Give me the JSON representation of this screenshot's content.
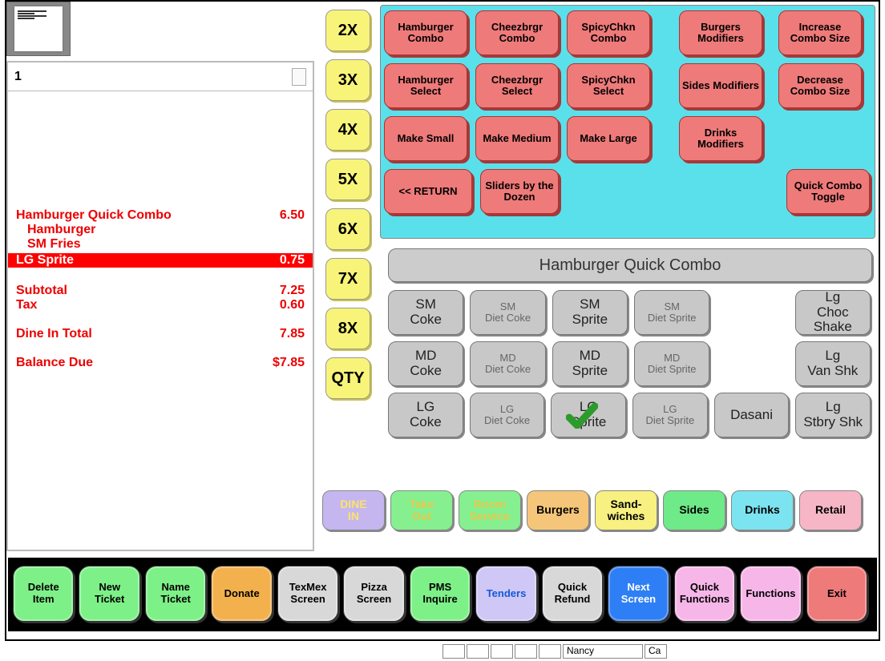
{
  "ticket": {
    "number": "1",
    "lines": [
      {
        "label": "Hamburger Quick Combo",
        "price": "6.50",
        "type": "row"
      },
      {
        "label": "Hamburger",
        "type": "indent"
      },
      {
        "label": "SM Fries",
        "type": "indent"
      },
      {
        "label": "LG Sprite",
        "price": "0.75",
        "type": "selected"
      }
    ],
    "subtotal_label": "Subtotal",
    "subtotal": "7.25",
    "tax_label": "Tax",
    "tax": "0.60",
    "total_label": "Dine In Total",
    "total": "7.85",
    "balance_label": "Balance Due",
    "balance": "$7.85"
  },
  "qty_buttons": [
    "2X",
    "3X",
    "4X",
    "5X",
    "6X",
    "7X",
    "8X",
    "QTY"
  ],
  "combo_grid": {
    "row1": [
      "Hamburger Combo",
      "Cheezbrgr Combo",
      "SpicyChkn Combo",
      "Burgers Modifiers",
      "Increase Combo Size"
    ],
    "row2": [
      "Hamburger Select",
      "Cheezbrgr Select",
      "SpicyChkn Select",
      "Sides Modifiers",
      "Decrease Combo Size"
    ],
    "row3": [
      "Make Small",
      "Make Medium",
      "Make Large",
      "Drinks Modifiers"
    ],
    "row4": [
      "<< RETURN",
      "Sliders by the Dozen",
      "Quick Combo Toggle"
    ]
  },
  "item_title": "Hamburger Quick Combo",
  "drinks": {
    "row1": [
      {
        "t": "SM Coke",
        "s": "big"
      },
      {
        "t": "SM Diet Coke",
        "s": "dim"
      },
      {
        "t": "SM Sprite",
        "s": "big"
      },
      {
        "t": "SM Diet Sprite",
        "s": "dim"
      },
      {
        "t": "Lg Choc Shake",
        "s": "big",
        "end": true
      }
    ],
    "row2": [
      {
        "t": "MD Coke",
        "s": "big"
      },
      {
        "t": "MD Diet Coke",
        "s": "dim"
      },
      {
        "t": "MD Sprite",
        "s": "big"
      },
      {
        "t": "MD Diet Sprite",
        "s": "dim"
      },
      {
        "t": "Lg Van Shk",
        "s": "big",
        "end": true
      }
    ],
    "row3": [
      {
        "t": "LG Coke",
        "s": "big"
      },
      {
        "t": "LG Diet Coke",
        "s": "dim"
      },
      {
        "t": "LG Sprite",
        "s": "big",
        "checked": true
      },
      {
        "t": "LG Diet Sprite",
        "s": "dim"
      },
      {
        "t": "Dasani",
        "s": "big"
      },
      {
        "t": "Lg Stbry Shk",
        "s": "big",
        "end": true
      }
    ]
  },
  "categories": [
    {
      "t": "DINE IN",
      "c": "c-purple"
    },
    {
      "t": "Take Out",
      "c": "c-green"
    },
    {
      "t": "Room Service",
      "c": "c-green"
    },
    {
      "t": "Burgers",
      "c": "c-orange"
    },
    {
      "t": "Sand- wiches",
      "c": "c-yellow"
    },
    {
      "t": "Sides",
      "c": "c-green2"
    },
    {
      "t": "Drinks",
      "c": "c-cyan"
    },
    {
      "t": "Retail",
      "c": "c-pink"
    }
  ],
  "bottom": [
    {
      "t": "Delete Item",
      "c": "b-green"
    },
    {
      "t": "New Ticket",
      "c": "b-green"
    },
    {
      "t": "Name Ticket",
      "c": "b-green"
    },
    {
      "t": "Donate",
      "c": "b-orange"
    },
    {
      "t": "TexMex Screen",
      "c": "b-gray"
    },
    {
      "t": "Pizza Screen",
      "c": "b-gray"
    },
    {
      "t": "PMS Inquire",
      "c": "b-green"
    },
    {
      "t": "Tenders",
      "c": "b-lav"
    },
    {
      "t": "Quick Refund",
      "c": "b-gray"
    },
    {
      "t": "Next Screen",
      "c": "b-blue"
    },
    {
      "t": "Quick Functions",
      "c": "b-pink"
    },
    {
      "t": "Functions",
      "c": "b-pink"
    },
    {
      "t": "Exit",
      "c": "b-red"
    }
  ],
  "status_user": "Nancy",
  "status_end": "Ca"
}
